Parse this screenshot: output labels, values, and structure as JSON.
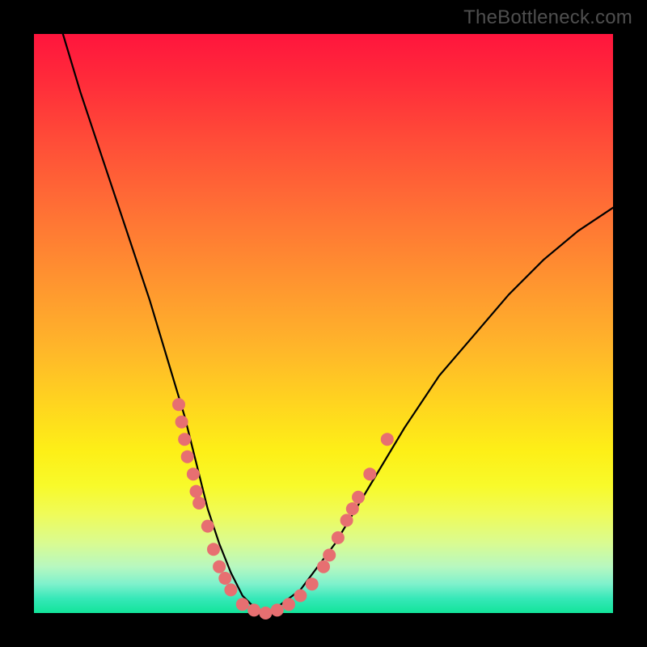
{
  "watermark": "TheBottleneck.com",
  "colors": {
    "frame": "#000000",
    "curve_stroke": "#000000",
    "marker_fill": "#e76f71",
    "marker_stroke": "#cf5a5d",
    "gradient_top": "#ff153d",
    "gradient_bottom": "#12e49a"
  },
  "chart_data": {
    "type": "line",
    "title": "",
    "xlabel": "",
    "ylabel": "",
    "xlim": [
      0,
      100
    ],
    "ylim": [
      0,
      100
    ],
    "series": [
      {
        "name": "bottleneck-curve",
        "x": [
          5,
          8,
          12,
          16,
          20,
          23,
          26,
          28,
          30,
          32,
          34,
          36,
          38,
          40,
          42,
          46,
          52,
          58,
          64,
          70,
          76,
          82,
          88,
          94,
          100
        ],
        "y": [
          100,
          90,
          78,
          66,
          54,
          44,
          34,
          26,
          18,
          12,
          7,
          3,
          1,
          0,
          1,
          4,
          12,
          22,
          32,
          41,
          48,
          55,
          61,
          66,
          70
        ]
      }
    ],
    "markers": [
      {
        "x": 25,
        "y": 36
      },
      {
        "x": 25.5,
        "y": 33
      },
      {
        "x": 26,
        "y": 30
      },
      {
        "x": 26.5,
        "y": 27
      },
      {
        "x": 27.5,
        "y": 24
      },
      {
        "x": 28,
        "y": 21
      },
      {
        "x": 28.5,
        "y": 19
      },
      {
        "x": 30,
        "y": 15
      },
      {
        "x": 31,
        "y": 11
      },
      {
        "x": 32,
        "y": 8
      },
      {
        "x": 33,
        "y": 6
      },
      {
        "x": 34,
        "y": 4
      },
      {
        "x": 36,
        "y": 1.5
      },
      {
        "x": 38,
        "y": 0.5
      },
      {
        "x": 40,
        "y": 0
      },
      {
        "x": 42,
        "y": 0.5
      },
      {
        "x": 44,
        "y": 1.5
      },
      {
        "x": 46,
        "y": 3
      },
      {
        "x": 48,
        "y": 5
      },
      {
        "x": 50,
        "y": 8
      },
      {
        "x": 51,
        "y": 10
      },
      {
        "x": 52.5,
        "y": 13
      },
      {
        "x": 54,
        "y": 16
      },
      {
        "x": 55,
        "y": 18
      },
      {
        "x": 56,
        "y": 20
      },
      {
        "x": 58,
        "y": 24
      },
      {
        "x": 61,
        "y": 30
      }
    ]
  }
}
